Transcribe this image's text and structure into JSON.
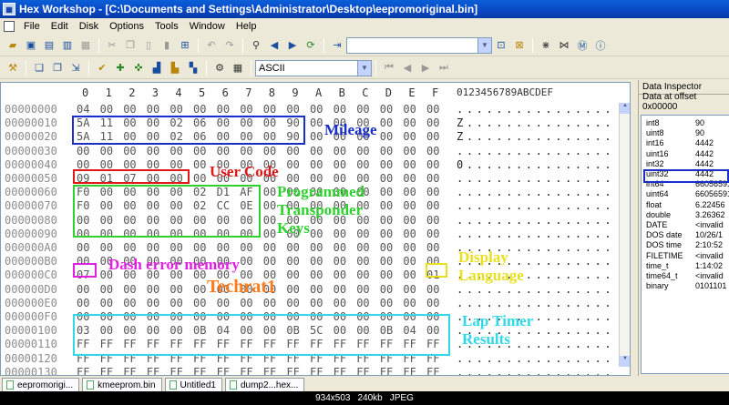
{
  "app": {
    "title": "Hex Workshop - [C:\\Documents and Settings\\Administrator\\Desktop\\eepromoriginal.bin]"
  },
  "menu": [
    "File",
    "Edit",
    "Disk",
    "Options",
    "Tools",
    "Window",
    "Help"
  ],
  "toolbar2": {
    "encoding": "ASCII"
  },
  "editor": {
    "header": {
      "cols": [
        "0",
        "1",
        "2",
        "3",
        "4",
        "5",
        "6",
        "7",
        "8",
        "9",
        "A",
        "B",
        "C",
        "D",
        "E",
        "F"
      ],
      "ascii": "0123456789ABCDEF"
    },
    "rows": [
      {
        "addr": "00000000",
        "hex": [
          "04",
          "00",
          "00",
          "00",
          "00",
          "00",
          "00",
          "00",
          "00",
          "00",
          "00",
          "00",
          "00",
          "00",
          "00",
          "00"
        ],
        "ascii": "................"
      },
      {
        "addr": "00000010",
        "hex": [
          "5A",
          "11",
          "00",
          "00",
          "02",
          "06",
          "00",
          "00",
          "00",
          "90",
          "00",
          "00",
          "00",
          "00",
          "00",
          "00"
        ],
        "ascii": "Z..............."
      },
      {
        "addr": "00000020",
        "hex": [
          "5A",
          "11",
          "00",
          "00",
          "02",
          "06",
          "00",
          "00",
          "00",
          "90",
          "00",
          "00",
          "00",
          "00",
          "00",
          "00"
        ],
        "ascii": "Z..............."
      },
      {
        "addr": "00000030",
        "hex": [
          "00",
          "00",
          "00",
          "00",
          "00",
          "00",
          "00",
          "00",
          "00",
          "00",
          "00",
          "00",
          "00",
          "00",
          "00",
          "00"
        ],
        "ascii": "................"
      },
      {
        "addr": "00000040",
        "hex": [
          "00",
          "00",
          "00",
          "00",
          "00",
          "00",
          "00",
          "00",
          "00",
          "00",
          "00",
          "00",
          "00",
          "00",
          "00",
          "00"
        ],
        "ascii": "0..............."
      },
      {
        "addr": "00000050",
        "hex": [
          "09",
          "01",
          "07",
          "00",
          "00",
          "00",
          "00",
          "00",
          "00",
          "00",
          "00",
          "00",
          "00",
          "00",
          "00",
          "00"
        ],
        "ascii": "................"
      },
      {
        "addr": "00000060",
        "hex": [
          "F0",
          "00",
          "00",
          "00",
          "00",
          "02",
          "D1",
          "AF",
          "00",
          "00",
          "00",
          "00",
          "00",
          "00",
          "00",
          "00"
        ],
        "ascii": "................"
      },
      {
        "addr": "00000070",
        "hex": [
          "F0",
          "00",
          "00",
          "00",
          "00",
          "02",
          "CC",
          "0E",
          "00",
          "00",
          "00",
          "00",
          "00",
          "00",
          "00",
          "00"
        ],
        "ascii": "................"
      },
      {
        "addr": "00000080",
        "hex": [
          "00",
          "00",
          "00",
          "00",
          "00",
          "00",
          "00",
          "00",
          "00",
          "00",
          "00",
          "00",
          "00",
          "00",
          "00",
          "00"
        ],
        "ascii": "................"
      },
      {
        "addr": "00000090",
        "hex": [
          "00",
          "00",
          "00",
          "00",
          "00",
          "00",
          "00",
          "00",
          "00",
          "00",
          "00",
          "00",
          "00",
          "00",
          "00",
          "00"
        ],
        "ascii": "................"
      },
      {
        "addr": "000000A0",
        "hex": [
          "00",
          "00",
          "00",
          "00",
          "00",
          "00",
          "00",
          "00",
          "00",
          "00",
          "00",
          "00",
          "00",
          "00",
          "00",
          "00"
        ],
        "ascii": "................"
      },
      {
        "addr": "000000B0",
        "hex": [
          "00",
          "00",
          "00",
          "00",
          "00",
          "00",
          "00",
          "00",
          "00",
          "00",
          "00",
          "00",
          "00",
          "00",
          "00",
          "00"
        ],
        "ascii": "................"
      },
      {
        "addr": "000000C0",
        "hex": [
          "07",
          "00",
          "00",
          "00",
          "00",
          "00",
          "00",
          "00",
          "00",
          "00",
          "00",
          "00",
          "00",
          "00",
          "00",
          "01"
        ],
        "ascii": "................"
      },
      {
        "addr": "000000D0",
        "hex": [
          "00",
          "00",
          "00",
          "00",
          "00",
          "00",
          "00",
          "00",
          "00",
          "00",
          "00",
          "00",
          "00",
          "00",
          "00",
          "00"
        ],
        "ascii": "................"
      },
      {
        "addr": "000000E0",
        "hex": [
          "00",
          "00",
          "00",
          "00",
          "00",
          "00",
          "00",
          "00",
          "00",
          "00",
          "00",
          "00",
          "00",
          "00",
          "00",
          "00"
        ],
        "ascii": "................"
      },
      {
        "addr": "000000F0",
        "hex": [
          "00",
          "00",
          "00",
          "00",
          "00",
          "00",
          "00",
          "00",
          "00",
          "00",
          "00",
          "00",
          "00",
          "00",
          "00",
          "00"
        ],
        "ascii": "................"
      },
      {
        "addr": "00000100",
        "hex": [
          "03",
          "00",
          "00",
          "00",
          "00",
          "0B",
          "04",
          "00",
          "00",
          "0B",
          "5C",
          "00",
          "00",
          "0B",
          "04",
          "00"
        ],
        "ascii": "................"
      },
      {
        "addr": "00000110",
        "hex": [
          "FF",
          "FF",
          "FF",
          "FF",
          "FF",
          "FF",
          "FF",
          "FF",
          "FF",
          "FF",
          "FF",
          "FF",
          "FF",
          "FF",
          "FF",
          "FF"
        ],
        "ascii": "................"
      },
      {
        "addr": "00000120",
        "hex": [
          "FF",
          "FF",
          "FF",
          "FF",
          "FF",
          "FF",
          "FF",
          "FF",
          "FF",
          "FF",
          "FF",
          "FF",
          "FF",
          "FF",
          "FF",
          "FF"
        ],
        "ascii": "................"
      },
      {
        "addr": "00000130",
        "hex": [
          "FF",
          "FF",
          "FF",
          "FF",
          "FF",
          "FF",
          "FF",
          "FF",
          "FF",
          "FF",
          "FF",
          "FF",
          "FF",
          "FF",
          "FF",
          "FF"
        ],
        "ascii": "................"
      }
    ]
  },
  "annotations": {
    "mileage": "Mileage",
    "user_code": "User Code",
    "programmed_transponder_keys": "Programmed Transponder Keys",
    "dash_error_memory": "Dash error memory",
    "display_language": "Display Language",
    "techrat": "Techrat1",
    "lap_timer_results": "Lap Timer Results"
  },
  "inspector": {
    "title": "Data Inspector",
    "offset_label": "Data at offset 0x00000",
    "rows": [
      {
        "k": "int8",
        "v": "90"
      },
      {
        "k": "uint8",
        "v": "90"
      },
      {
        "k": "int16",
        "v": "4442"
      },
      {
        "k": "uint16",
        "v": "4442"
      },
      {
        "k": "int32",
        "v": "4442"
      },
      {
        "k": "uint32",
        "v": "4442"
      },
      {
        "k": "int64",
        "v": "66056591"
      },
      {
        "k": "uint64",
        "v": "66056591"
      },
      {
        "k": "float",
        "v": "6.22456"
      },
      {
        "k": "double",
        "v": "3.26362"
      },
      {
        "k": "DATE",
        "v": "<invalid"
      },
      {
        "k": "DOS date",
        "v": "10/26/1"
      },
      {
        "k": "DOS time",
        "v": "2:10:52"
      },
      {
        "k": "FILETIME",
        "v": "<invalid"
      },
      {
        "k": "time_t",
        "v": "1:14:02"
      },
      {
        "k": "time64_t",
        "v": "<invalid"
      },
      {
        "k": "binary",
        "v": "0101101"
      }
    ]
  },
  "tabs": [
    "eepromorigi...",
    "kmeeprom.bin",
    "Untitled1",
    "dump2...hex..."
  ],
  "footer": {
    "dims": "934x503",
    "size": "240kb",
    "format": "JPEG"
  },
  "colors": {
    "mileage": "#1a2fc8",
    "user_code": "#e01818",
    "keys": "#2fd12f",
    "dash_error": "#e020e0",
    "display_language": "#e8e020",
    "techrat": "#ff7a1a",
    "lap_timer": "#30d8e8",
    "inspector_highlight": "#1a2fc8"
  }
}
